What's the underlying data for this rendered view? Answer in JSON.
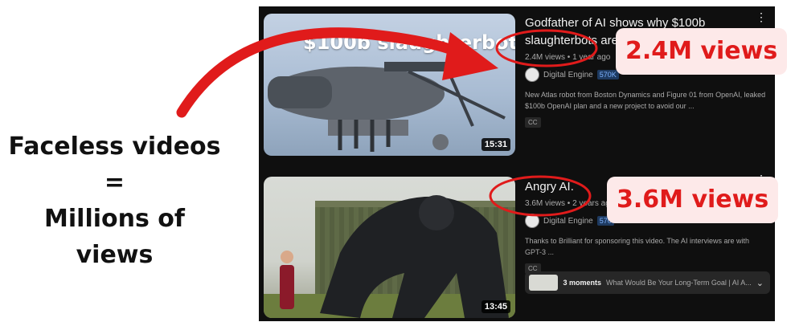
{
  "caption": {
    "line1": "Faceless videos",
    "line2": "=",
    "line3": "Millions of",
    "line4": "views"
  },
  "videos": [
    {
      "thumb_text": "$100b slaughterbots",
      "duration": "15:31",
      "title": "Godfather of AI shows why $100b slaughterbots are a",
      "meta": "2.4M views • 1 year ago",
      "channel": "Digital Engine",
      "subs": "570K",
      "description": "New Atlas robot from Boston Dynamics and Figure 01 from OpenAI, leaked $100b OpenAI plan and a new project to avoid our ...",
      "cc": "CC"
    },
    {
      "duration": "13:45",
      "title": "Angry AI.",
      "meta": "3.6M views • 2 years ago",
      "channel": "Digital Engine",
      "subs": "570",
      "description": "Thanks to Brilliant for sponsoring this video. The AI interviews are with GPT-3 ...",
      "cc": "CC",
      "moments_count": "3 moments",
      "moments_title": "What Would Be Your Long-Term Goal | AI A..."
    }
  ],
  "callouts": [
    "2.4M views",
    "3.6M views"
  ],
  "icons": {
    "more": "⋮",
    "chevron": "⌄"
  },
  "colors": {
    "accent_red": "#e01b1b",
    "callout_bg": "#fde9e9",
    "panel_bg": "#0f0f0f"
  }
}
